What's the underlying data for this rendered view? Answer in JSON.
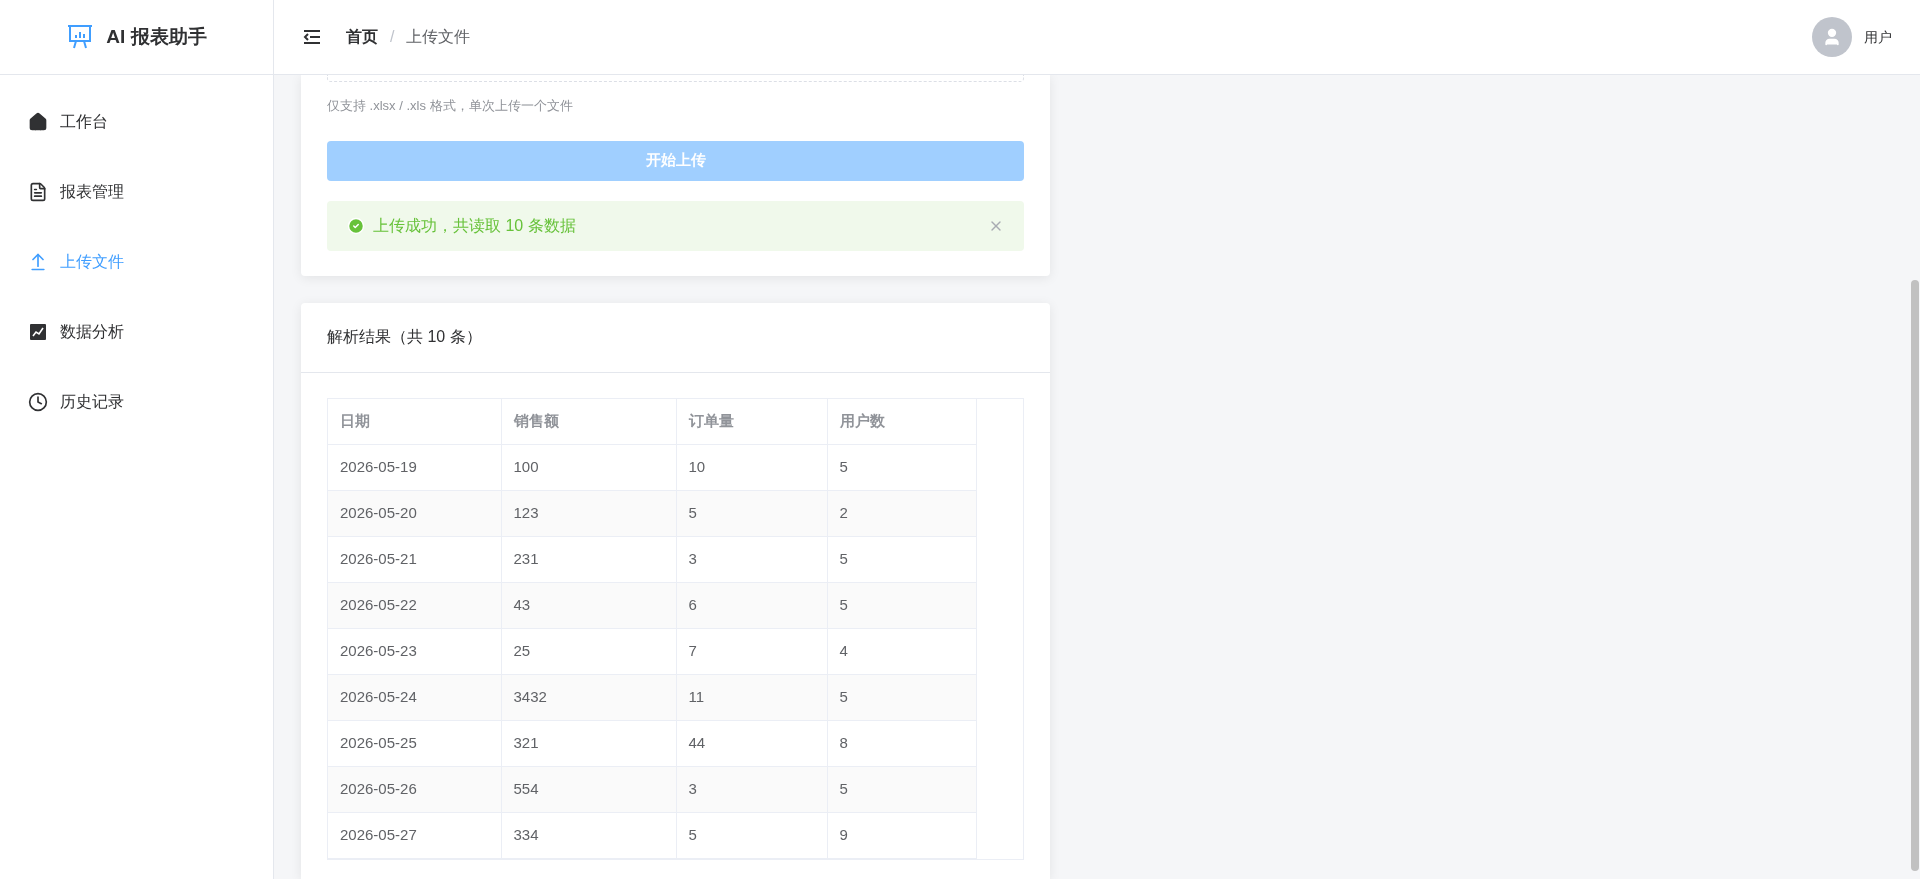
{
  "app": {
    "title": "AI 报表助手"
  },
  "sidebar": {
    "items": [
      {
        "label": "工作台",
        "kind": "home",
        "selected": false
      },
      {
        "label": "报表管理",
        "kind": "document",
        "selected": false
      },
      {
        "label": "上传文件",
        "kind": "upload",
        "selected": true
      },
      {
        "label": "数据分析",
        "kind": "chart",
        "selected": false
      },
      {
        "label": "历史记录",
        "kind": "clock",
        "selected": false
      }
    ]
  },
  "breadcrumb": [
    {
      "label": "首页",
      "current": false
    },
    {
      "label": "上传文件",
      "current": true
    }
  ],
  "breadcrumb_separator": "/",
  "user": {
    "name": "用户"
  },
  "upload": {
    "hint": "仅支持 .xlsx / .xls 格式，单次上传一个文件",
    "button": {
      "label": "开始上传",
      "disabled": true
    },
    "alert": {
      "kind": "success",
      "message": "上传成功，共读取 10 条数据"
    }
  },
  "result": {
    "title": "解析结果（共 10 条）",
    "table": {
      "columns": [
        "日期",
        "销售额",
        "订单量",
        "用户数"
      ],
      "rows": [
        [
          "2026-05-19",
          "100",
          "10",
          "5"
        ],
        [
          "2026-05-20",
          "123",
          "5",
          "2"
        ],
        [
          "2026-05-21",
          "231",
          "3",
          "5"
        ],
        [
          "2026-05-22",
          "43",
          "6",
          "5"
        ],
        [
          "2026-05-23",
          "25",
          "7",
          "4"
        ],
        [
          "2026-05-24",
          "3432",
          "11",
          "5"
        ],
        [
          "2026-05-25",
          "321",
          "44",
          "8"
        ],
        [
          "2026-05-26",
          "554",
          "3",
          "5"
        ],
        [
          "2026-05-27",
          "334",
          "5",
          "9"
        ]
      ]
    }
  }
}
